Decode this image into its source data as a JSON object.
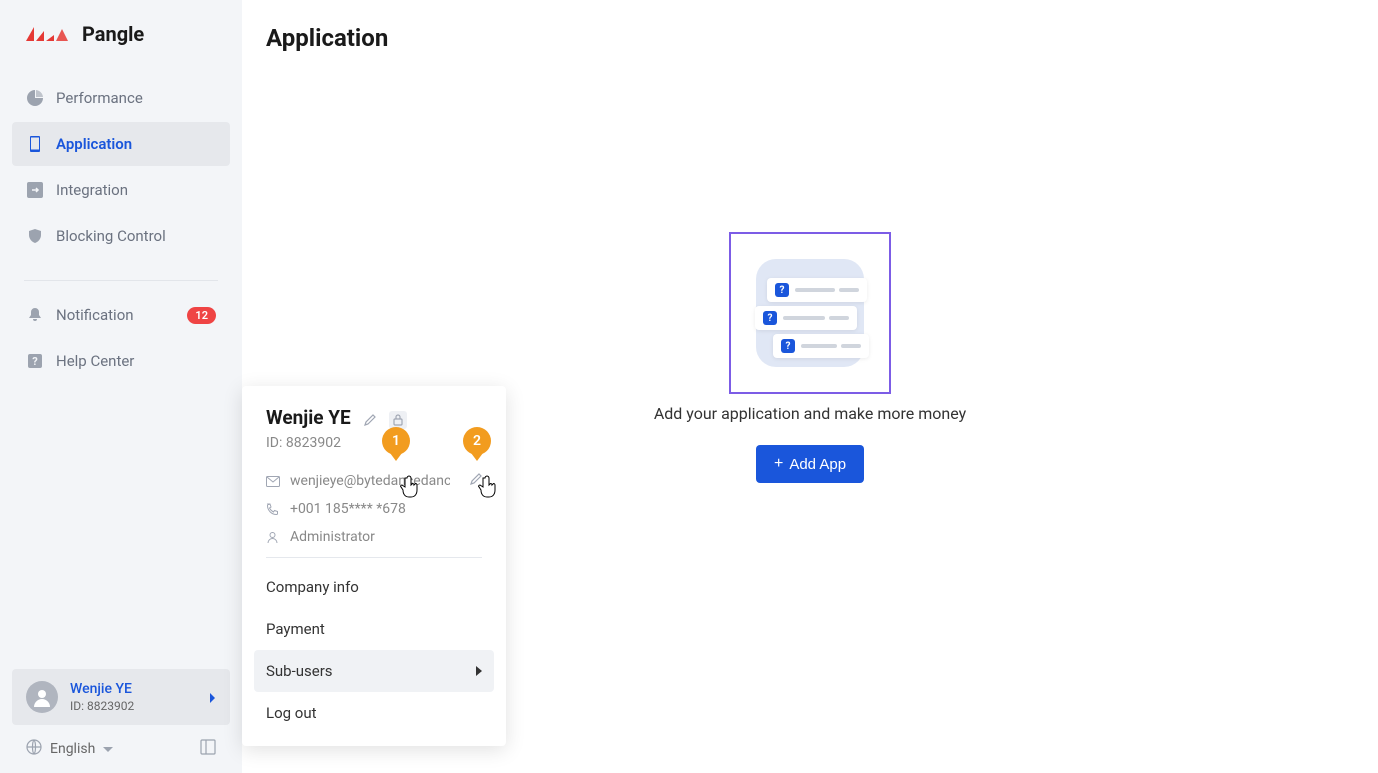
{
  "logo": "Pangle",
  "sidebar": {
    "items": [
      {
        "label": "Performance",
        "icon": "pie-chart"
      },
      {
        "label": "Application",
        "icon": "device",
        "active": true
      },
      {
        "label": "Integration",
        "icon": "arrow-right-box"
      },
      {
        "label": "Blocking Control",
        "icon": "shield"
      }
    ],
    "secondary": [
      {
        "label": "Notification",
        "icon": "bell",
        "badge": "12"
      },
      {
        "label": "Help Center",
        "icon": "question"
      }
    ]
  },
  "user": {
    "name": "Wenjie YE",
    "id_label": "ID: 8823902"
  },
  "lang": {
    "label": "English"
  },
  "page": {
    "title": "Application",
    "empty_text": "Add your application and make more money",
    "add_button": "Add App"
  },
  "popover": {
    "name": "Wenjie YE",
    "id_label": "ID: 8823902",
    "email": "wenjieye@bytedancedancec...",
    "phone": "+001 185**** *678",
    "role": "Administrator",
    "menu": {
      "company": "Company info",
      "payment": "Payment",
      "subusers": "Sub-users",
      "logout": "Log out"
    }
  },
  "callouts": {
    "one": "1",
    "two": "2"
  }
}
